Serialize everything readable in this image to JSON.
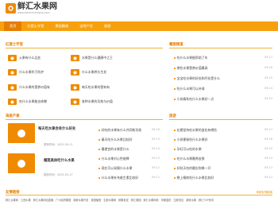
{
  "site": {
    "title": "鲜汇水果网",
    "subtitle": "www.xianhuishuiguo.com"
  },
  "nav": [
    {
      "label": "首页",
      "active": true
    },
    {
      "label": "红提士学堂"
    },
    {
      "label": "果园趣闻"
    },
    {
      "label": "当地产货"
    },
    {
      "label": "旅游"
    }
  ],
  "knowledge": {
    "title": "红提士学堂",
    "tiles": [
      {
        "label": "火果有什么品处"
      },
      {
        "label": "水果是什么健康中之王"
      },
      {
        "label": "什么水果利于防护"
      },
      {
        "label": "什么水果养头生发"
      },
      {
        "label": "什么水果的营养价值有"
      },
      {
        "label": "每天吃水果的营有有"
      },
      {
        "label": "吃什么水果能去咳嗽"
      },
      {
        "label": "各种水果的功效与价值"
      }
    ]
  },
  "recommend": {
    "title": "看图频道",
    "items": [
      {
        "title": "吃什么水果能帮助了年",
        "date": "09-17"
      },
      {
        "title": "哪些水果营养价值最高",
        "date": "09-16"
      },
      {
        "title": "宝宝吃水果的好处和坏处是什么",
        "date": "09-15"
      },
      {
        "title": "吃什么水果可以补肾",
        "date": "09-14"
      },
      {
        "title": "小孩春秋吃什么水果好一点",
        "date": "09-13"
      }
    ]
  },
  "news": {
    "title": "海南产果",
    "featured": [
      {
        "title": "每天吃水果会有什么好处",
        "date": "更新时间：2025-09-21"
      },
      {
        "title": "榴莲具体吃什么水果",
        "date": "更新时间：2025-09-17"
      }
    ],
    "items": [
      {
        "title": "好吃的水果有什么共同和功效",
        "date": "09-16"
      },
      {
        "title": "秦天吃什么水果比较好",
        "date": "09-15"
      },
      {
        "title": "最便宜的水果是什么",
        "date": "09-14"
      },
      {
        "title": "什么水果对心性能降",
        "date": "09-13"
      },
      {
        "title": "现在可以采摘什么水果",
        "date": "09-12"
      },
      {
        "title": "什么水果补充维生素比较好",
        "date": "09-11"
      }
    ]
  },
  "travel": {
    "title": "旅游",
    "items": [
      {
        "title": "长期坚持吃水果的变化有哪些",
        "date": "09-17"
      },
      {
        "title": "小孩便秘吃什么水果好",
        "date": "09-16"
      },
      {
        "title": "孕妇可以吃的水果",
        "date": "09-15"
      },
      {
        "title": "吃什么水果最养皮肤",
        "date": "09-14"
      },
      {
        "title": "好秋天吃的最实和果一开",
        "date": "09-13"
      },
      {
        "title": "晚上睡前吃什么水果比较好",
        "date": "09-12"
      }
    ]
  },
  "more_label": "更多>>",
  "links_title": "友情链接",
  "links_more": "申请友情链接",
  "links": [
    "鲜汇水果网",
    "江西水果",
    "鲜汇水果网站直播",
    "广州油饼果园",
    "新鲜水果开发",
    "泰国榴莲",
    "生鲜水果网",
    "鲜果批发",
    "鲜汇果园",
    "鲜汇水果网地",
    "苹果直供",
    "生鲜供应",
    "新鲜水果",
    "鲜汇TOP资讯"
  ],
  "colors": {
    "accent": "#f7a00e",
    "accent_dark": "#e67e00"
  }
}
